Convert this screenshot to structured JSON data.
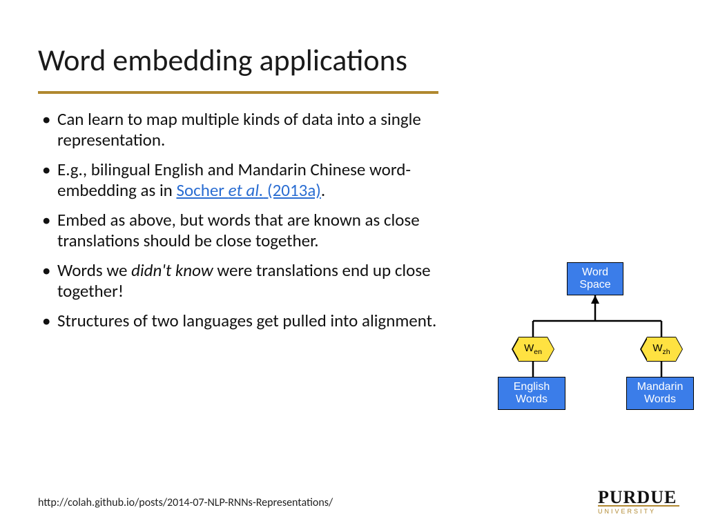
{
  "title": "Word embedding applications",
  "bullets": [
    {
      "text_a": "Can learn to map multiple kinds of data into a single representation."
    },
    {
      "text_a": "E.g., bilingual English and Mandarin Chinese word-embedding as in ",
      "link_nonitalic": "Socher ",
      "link_italic": "et al.",
      "link_tail": " (2013a)",
      "text_b": "."
    },
    {
      "text_a": "Embed as above, but words that are known as close translations should be close together."
    },
    {
      "text_a": "Words we ",
      "emph": "didn't know",
      "text_b": " were translations end up close together!"
    },
    {
      "text_a": "Structures of two languages get pulled into alignment."
    }
  ],
  "diagram": {
    "word_space": "Word\nSpace",
    "w_en": "W",
    "w_en_sub": "en",
    "w_zh": "W",
    "w_zh_sub": "zh",
    "english": "English\nWords",
    "mandarin": "Mandarin\nWords"
  },
  "footer_url": "http://colah.github.io/posts/2014-07-NLP-RNNs-Representations/",
  "logo": {
    "name": "PURDUE",
    "univ": "UNIVERSITY"
  }
}
